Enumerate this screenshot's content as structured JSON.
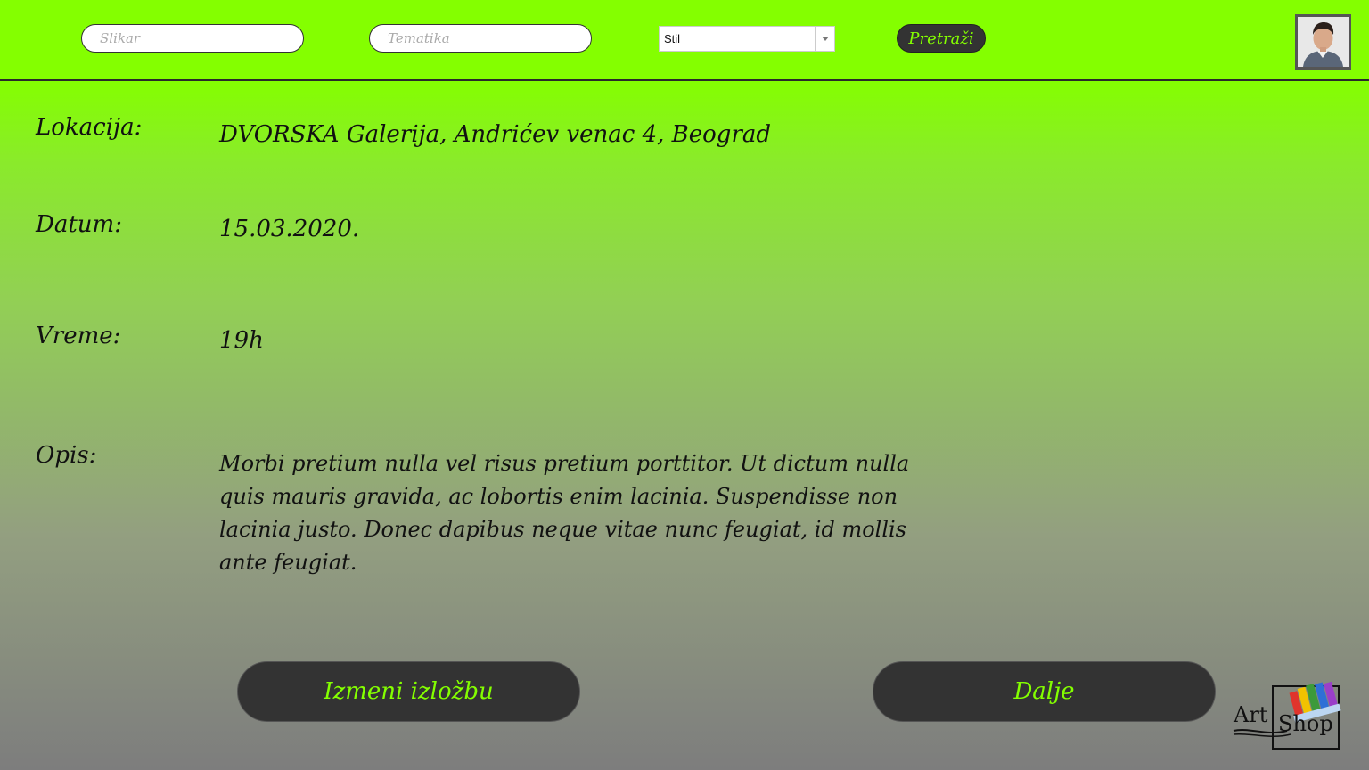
{
  "header": {
    "slikar_placeholder": "Slikar",
    "tematika_placeholder": "Tematika",
    "stil_value": "Stil",
    "search_label": "Pretraži"
  },
  "details": {
    "lokacija_label": "Lokacija:",
    "lokacija_value": "DVORSKA Galerija, Andrićev venac 4, Beograd",
    "datum_label": "Datum:",
    "datum_value": "15.03.2020.",
    "vreme_label": "Vreme:",
    "vreme_value": "19h",
    "opis_label": "Opis:",
    "opis_value": "Morbi pretium nulla vel risus pretium porttitor. Ut dictum nulla quis mauris gravida, ac lobortis enim lacinia. Suspendisse non lacinia justo. Donec dapibus neque vitae nunc feugiat, id mollis ante feugiat."
  },
  "actions": {
    "edit_label": "Izmeni izložbu",
    "next_label": "Dalje"
  },
  "logo": {
    "line1": "Art",
    "line2": "Shop"
  },
  "colors": {
    "accent": "#84ff00",
    "button_bg": "#333333"
  },
  "icons": {
    "dropdown": "chevron-down-icon",
    "avatar": "user-avatar",
    "logo": "paint-palette-icon"
  }
}
